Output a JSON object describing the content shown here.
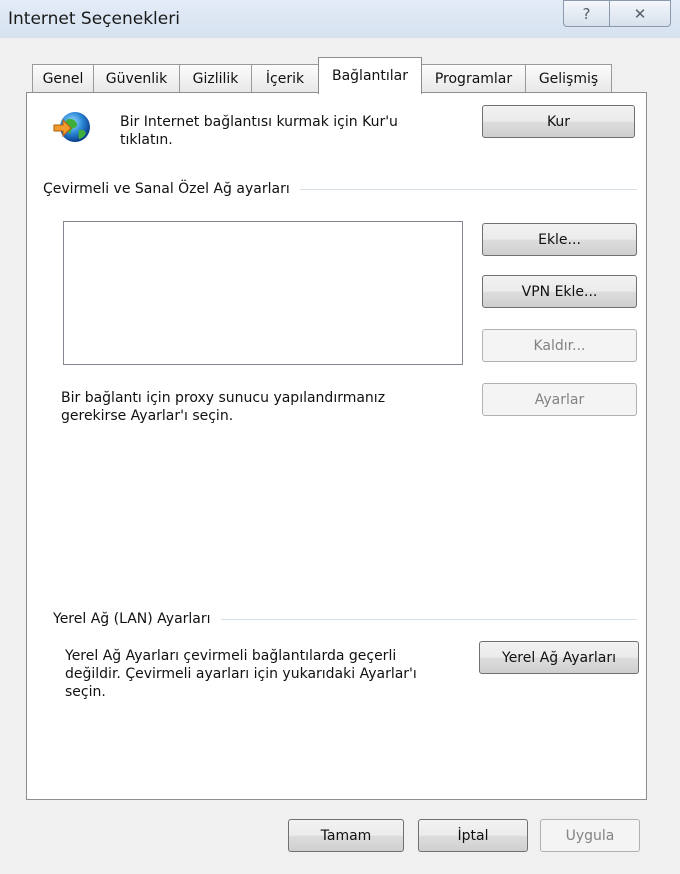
{
  "window": {
    "title": "Internet Seçenekleri",
    "help_glyph": "?",
    "close_glyph": "✕"
  },
  "tabs": [
    {
      "label": "Genel"
    },
    {
      "label": "Güvenlik"
    },
    {
      "label": "Gizlilik"
    },
    {
      "label": "İçerik"
    },
    {
      "label": "Bağlantılar",
      "active": true
    },
    {
      "label": "Programlar"
    },
    {
      "label": "Gelişmiş"
    }
  ],
  "setup": {
    "text": "Bir Internet bağlantısı kurmak için Kur'u tıklatın.",
    "button": "Kur",
    "icon": "globe-connection-icon"
  },
  "dialup": {
    "group_label": "Çevirmeli ve Sanal Özel Ağ ayarları",
    "add_button": "Ekle...",
    "add_vpn_button": "VPN Ekle...",
    "remove_button": "Kaldır...",
    "settings_button": "Ayarlar",
    "proxy_text": "Bir bağlantı için proxy sunucu yapılandırmanız gerekirse Ayarlar'ı seçin."
  },
  "lan": {
    "group_label": "Yerel Ağ (LAN) Ayarları",
    "text": "Yerel Ağ Ayarları çevirmeli bağlantılarda geçerli değildir. Çevirmeli ayarları için yukarıdaki Ayarlar'ı seçin.",
    "button": "Yerel Ağ Ayarları"
  },
  "footer": {
    "ok": "Tamam",
    "cancel": "İptal",
    "apply": "Uygula"
  }
}
